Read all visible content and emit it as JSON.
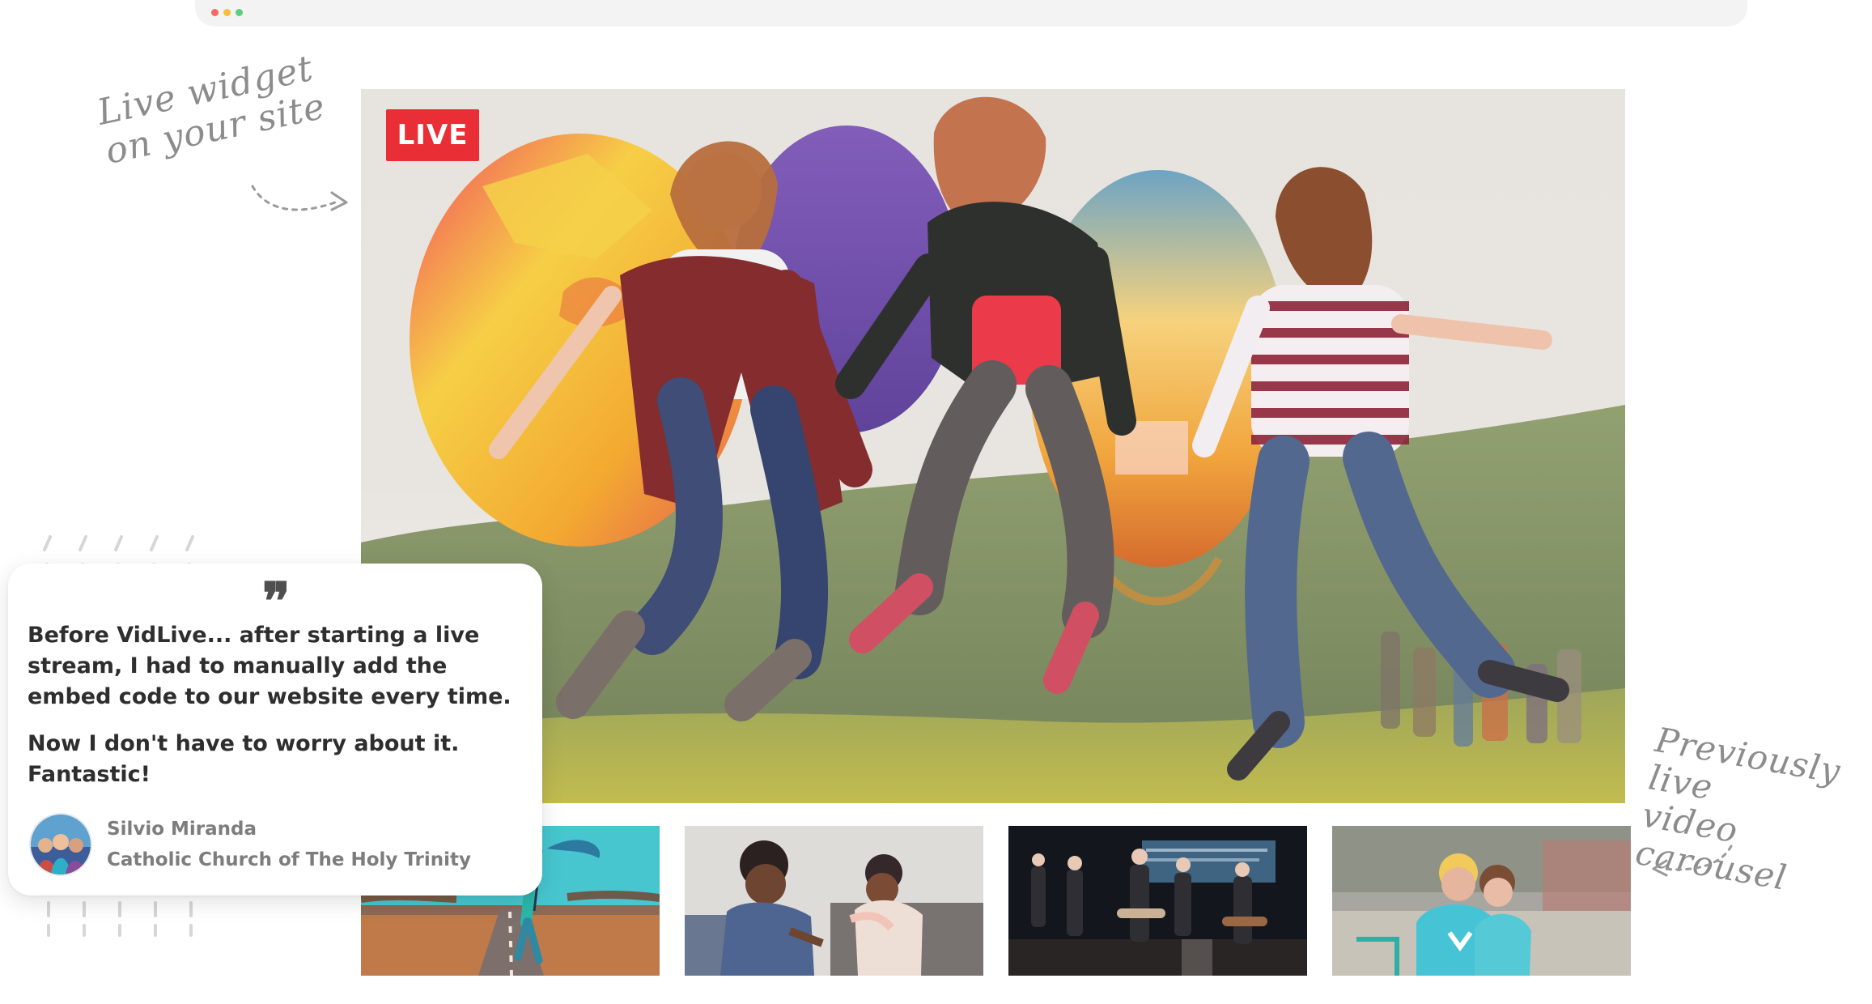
{
  "browser": {
    "dots": [
      {
        "name": "close-dot",
        "color": "#f66a5f"
      },
      {
        "name": "minimize-dot",
        "color": "#f8be3c"
      },
      {
        "name": "maximize-dot",
        "color": "#5dcd7f"
      }
    ]
  },
  "main_widget": {
    "live_label": "LIVE",
    "live_color": "#ea2e35"
  },
  "annotations": {
    "left_note": "Live widget\non your site",
    "right_note": "Previously live\nvideo carousel"
  },
  "testimonial": {
    "quote_icon": "quote-icon",
    "paragraph_1": "Before VidLive... after starting a live stream, I had to manually add the embed code to our website every time.",
    "paragraph_2": "Now I don't have to worry about it. Fantastic!",
    "author_name": "Silvio Miranda",
    "author_org": "Catholic Church of The Holy Trinity"
  },
  "colors": {
    "accent_red": "#ea2e35",
    "annotation_gray": "#8c8c8c",
    "text_dark": "#2e2e2e",
    "text_muted": "#7d7d7d"
  }
}
